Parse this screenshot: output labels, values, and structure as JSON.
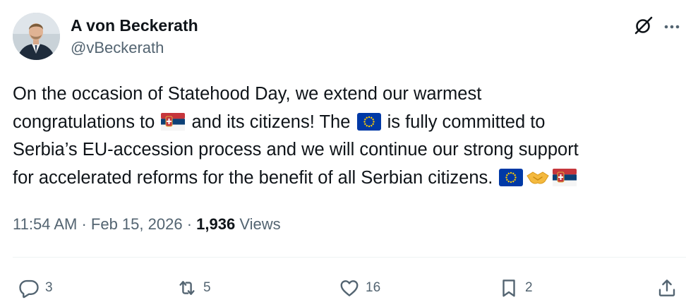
{
  "user": {
    "display_name": "A von Beckerath",
    "handle": "@vBeckerath"
  },
  "tweet": {
    "line1": "On the occasion of Statehood Day, we extend our warmest",
    "line2_a": "congratulations to",
    "line2_b": "and its citizens! The",
    "line2_c": "is fully committed to",
    "line3": "Serbia’s EU-accession process and we will continue our strong support",
    "line4": "for accelerated reforms for the benefit of all Serbian citizens.",
    "emojis": [
      "serbia-flag",
      "eu-flag",
      "handshake"
    ]
  },
  "meta": {
    "time": "11:54 AM",
    "separator": "·",
    "date": "Feb 15, 2026",
    "views_count": "1,936",
    "views_label": "Views"
  },
  "actions": {
    "reply_count": "3",
    "repost_count": "5",
    "like_count": "16",
    "bookmark_count": "2"
  },
  "colors": {
    "text_primary": "#0f1419",
    "text_secondary": "#536471",
    "divider": "#eff3f4",
    "eu_blue": "#0039a6",
    "eu_star": "#ffcc00",
    "serbia_red": "#c6363c",
    "serbia_blue": "#0c4076"
  }
}
